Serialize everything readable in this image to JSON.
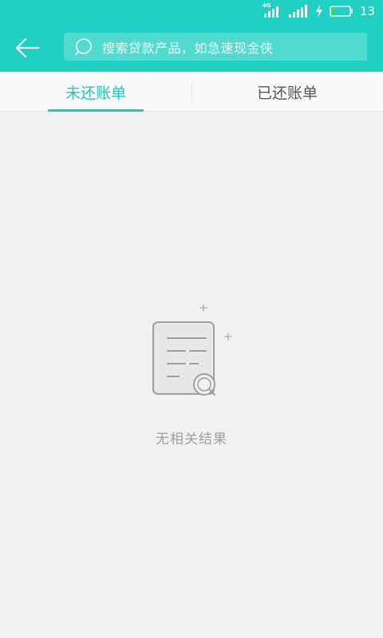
{
  "status_bar": {
    "network": "4G",
    "battery_level": "13",
    "charging_icon": "lightning-icon",
    "signal_icon": "signal-icon",
    "battery_icon": "battery-icon",
    "colors": {
      "battery_fill": "#27e04a"
    }
  },
  "header": {
    "back_icon": "arrow-left-icon",
    "search": {
      "icon": "search-icon",
      "placeholder": "搜索贷款产品，如急速现金侠"
    },
    "colors": {
      "background": "#1fd0c3"
    }
  },
  "tabs": [
    {
      "label": "未还账单",
      "active": true
    },
    {
      "label": "已还账单",
      "active": false
    }
  ],
  "empty_state": {
    "icon": "document-search-icon",
    "message": "无相关结果"
  },
  "colors": {
    "accent": "#1fc7b8",
    "page_background": "#f1f1f1"
  }
}
